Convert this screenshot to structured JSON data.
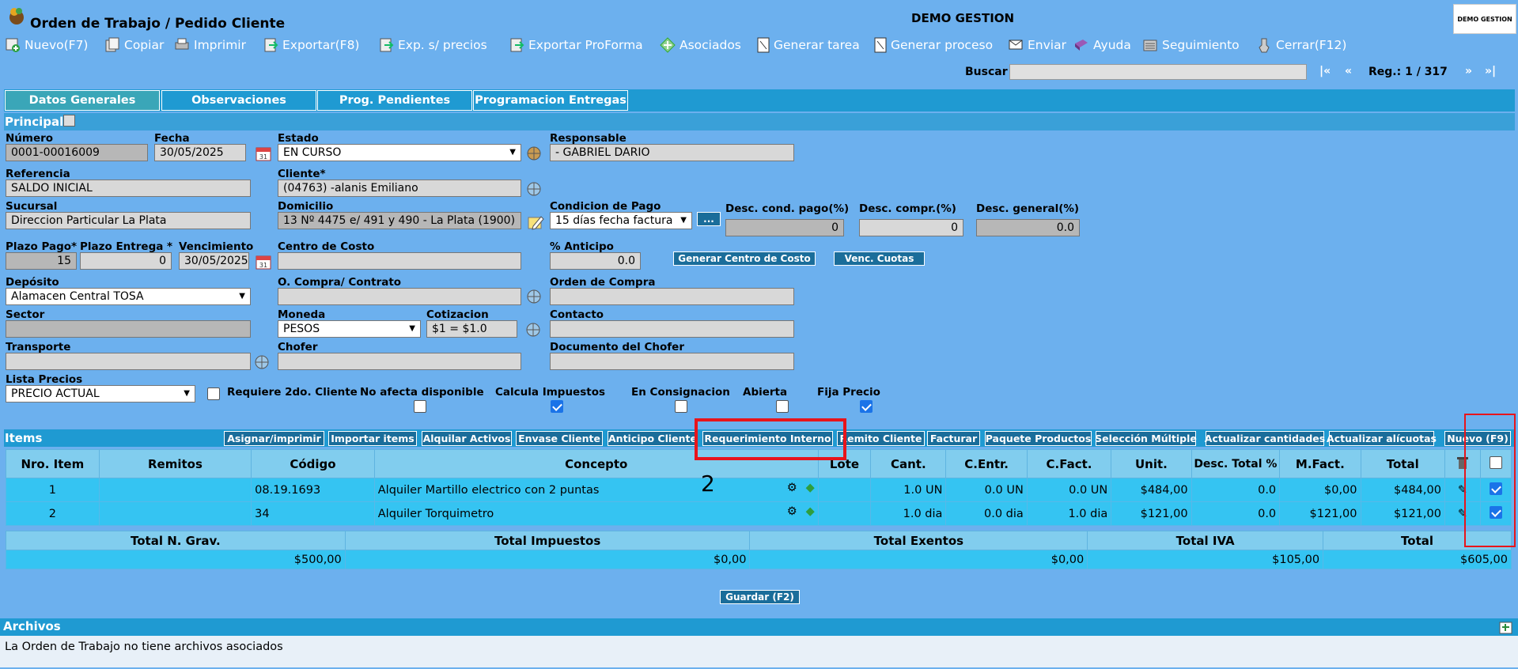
{
  "header": {
    "title": "Orden de Trabajo / Pedido Cliente",
    "company": "DEMO GESTION",
    "logo_text": "DEMO GESTION"
  },
  "toolbar": [
    {
      "label": "Nuevo(F7)",
      "icon": "add-icon"
    },
    {
      "label": "Copiar",
      "icon": "copy-icon"
    },
    {
      "label": "Imprimir",
      "icon": "print-icon"
    },
    {
      "label": "Exportar(F8)",
      "icon": "export-icon"
    },
    {
      "label": "Exp. s/ precios",
      "icon": "export-icon"
    },
    {
      "label": "Exportar ProForma",
      "icon": "export-icon"
    },
    {
      "label": "Asociados",
      "icon": "associated-icon"
    },
    {
      "label": "Generar tarea",
      "icon": "document-icon"
    },
    {
      "label": "Generar proceso",
      "icon": "document-icon"
    },
    {
      "label": "Enviar",
      "icon": "send-icon"
    },
    {
      "label": "Ayuda",
      "icon": "help-icon"
    },
    {
      "label": "Seguimiento",
      "icon": "tracking-icon"
    },
    {
      "label": "Cerrar(F12)",
      "icon": "close-icon"
    }
  ],
  "search": {
    "label": "Buscar",
    "value": "",
    "first": "|«",
    "prev": "«",
    "next": "»",
    "last": "»|",
    "reg": "Reg.: 1 / 317"
  },
  "tabs": [
    "Datos Generales",
    "Observaciones",
    "Prog. Pendientes",
    "Programacion Entregas"
  ],
  "principal": {
    "title": "Principal"
  },
  "fields": {
    "numero": {
      "label": "Número",
      "value": "0001-00016009"
    },
    "fecha": {
      "label": "Fecha",
      "value": "30/05/2025"
    },
    "estado": {
      "label": "Estado",
      "value": "EN CURSO"
    },
    "responsable": {
      "label": "Responsable",
      "value": "- GABRIEL DARIO"
    },
    "referencia": {
      "label": "Referencia",
      "value": "SALDO INICIAL"
    },
    "cliente": {
      "label": "Cliente*",
      "value": "(04763) -alanis Emiliano"
    },
    "sucursal": {
      "label": "Sucursal",
      "value": "Direccion Particular La Plata"
    },
    "domicilio": {
      "label": "Domicilio",
      "value": "13 Nº 4475 e/ 491 y 490 - La Plata (1900)"
    },
    "condicion_pago": {
      "label": "Condicion de Pago",
      "value": "15 días fecha factura",
      "more": "..."
    },
    "desc_cond_pago": {
      "label": "Desc. cond. pago(%)",
      "value": "0"
    },
    "desc_compr": {
      "label": "Desc. compr.(%)",
      "value": "0"
    },
    "desc_general": {
      "label": "Desc. general(%)",
      "value": "0.0"
    },
    "plazo_pago": {
      "label": "Plazo Pago*",
      "value": "15"
    },
    "plazo_entrega": {
      "label": "Plazo Entrega *",
      "value": "0"
    },
    "vencimiento": {
      "label": "Vencimiento",
      "value": "30/05/2025"
    },
    "centro_costo": {
      "label": "Centro de Costo",
      "value": ""
    },
    "anticipo": {
      "label": "% Anticipo",
      "value": "0.0"
    },
    "deposito": {
      "label": "Depósito",
      "value": "Alamacen Central TOSA"
    },
    "ocompra_contrato": {
      "label": "O. Compra/ Contrato",
      "value": ""
    },
    "orden_compra": {
      "label": "Orden de Compra",
      "value": ""
    },
    "sector": {
      "label": "Sector",
      "value": ""
    },
    "moneda": {
      "label": "Moneda",
      "value": "PESOS"
    },
    "cotizacion": {
      "label": "Cotizacion",
      "value": "$1 = $1.0"
    },
    "contacto": {
      "label": "Contacto",
      "value": ""
    },
    "transporte": {
      "label": "Transporte",
      "value": ""
    },
    "chofer": {
      "label": "Chofer",
      "value": ""
    },
    "documento_chofer": {
      "label": "Documento del Chofer",
      "value": ""
    },
    "lista_precios": {
      "label": "Lista Precios",
      "value": "PRECIO ACTUAL"
    }
  },
  "buttons": {
    "generar_cc": "Generar Centro de Costo",
    "venc_cuotas": "Venc. Cuotas",
    "save": "Guardar (F2)"
  },
  "checks": {
    "requiere": "Requiere 2do. Cliente",
    "no_afecta": "No afecta disponible",
    "calcula": "Calcula Impuestos",
    "consignacion": "En Consignacion",
    "abierta": "Abierta",
    "fija_precio": "Fija Precio"
  },
  "items_section": {
    "title": "Items",
    "buttons": [
      "Asignar/imprimir",
      "Importar items",
      "Alquilar Activos",
      "Envase Cliente",
      "Anticipo Cliente",
      "Requerimiento Interno",
      "Remito Cliente",
      "Facturar",
      "Paquete Productos",
      "Selección Múltiple",
      "Actualizar cantidades",
      "Actualizar alícuotas",
      "Nuevo (F9)"
    ]
  },
  "items_table": {
    "headers": [
      "Nro. Item",
      "Remitos",
      "Código",
      "Concepto",
      "Lote",
      "Cant.",
      "C.Entr.",
      "C.Fact.",
      "Unit.",
      "Desc. Total %",
      "M.Fact.",
      "Total"
    ],
    "rows": [
      {
        "nro": "1",
        "remitos": "",
        "codigo": "08.19.1693",
        "concepto": "Alquiler Martillo electrico con 2 puntas",
        "lote": "",
        "cant": "1.0 UN",
        "centr": "0.0 UN",
        "cfact": "0.0 UN",
        "unit": "$484,00",
        "desc": "0.0",
        "mfact": "$0,00",
        "total": "$484,00"
      },
      {
        "nro": "2",
        "remitos": "",
        "codigo": "34",
        "concepto": "Alquiler Torquimetro",
        "lote": "",
        "cant": "1.0 dia",
        "centr": "0.0 dia",
        "cfact": "1.0 dia",
        "unit": "$121,00",
        "desc": "0.0",
        "mfact": "$121,00",
        "total": "$121,00"
      }
    ]
  },
  "totals": {
    "headers": [
      "Total N. Grav.",
      "Total Impuestos",
      "Total Exentos",
      "Total IVA",
      "Total"
    ],
    "values": [
      "$500,00",
      "$0,00",
      "$0,00",
      "$105,00",
      "$605,00"
    ]
  },
  "archivos": {
    "title": "Archivos",
    "text": "La Orden de Trabajo no tiene archivos asociados"
  },
  "annotation": {
    "number": "2"
  },
  "colors": {
    "background": "#6cb0ee",
    "section": "#1f9ad2",
    "button": "#1a6d9a",
    "row": "#35c4f2",
    "highlight": "#e8141b"
  }
}
